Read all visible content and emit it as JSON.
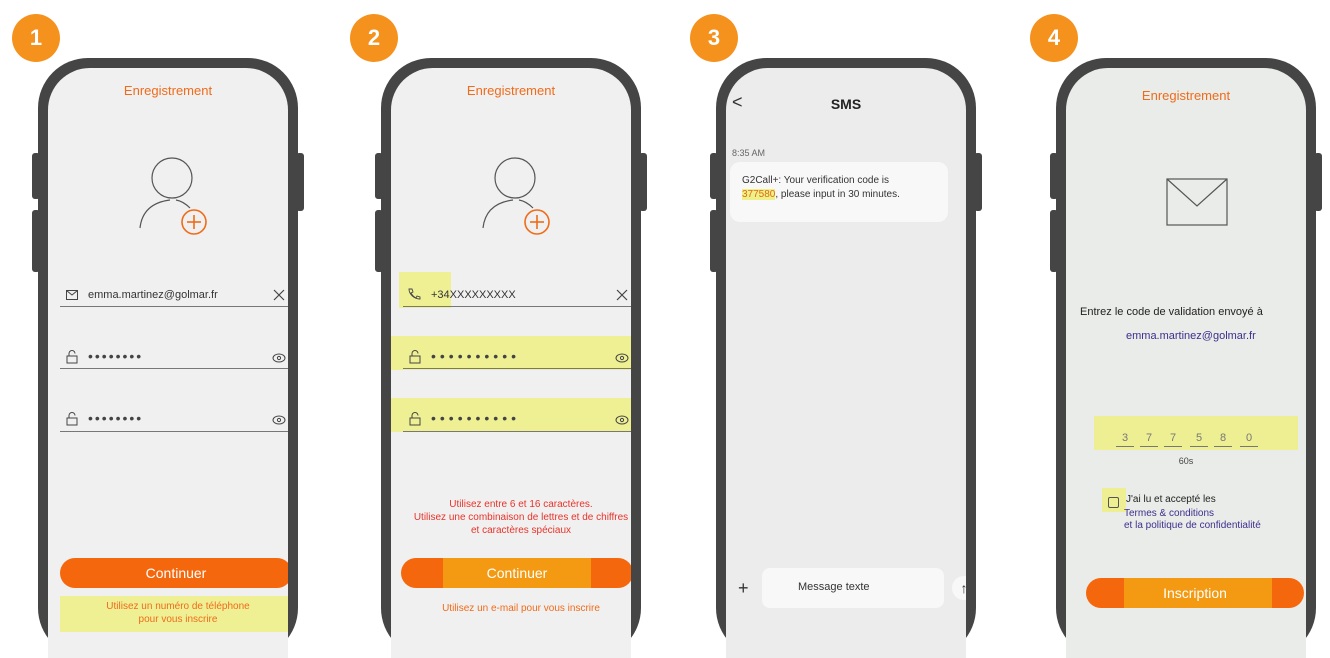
{
  "steps": [
    "1",
    "2",
    "3",
    "4"
  ],
  "screen1": {
    "title": "Enregistrement",
    "email_value": "emma.martinez@golmar.fr",
    "password_mask": "••••••••",
    "confirm_mask": "••••••••",
    "continue_label": "Continuer",
    "phone_link_line1": "Utilisez un numéro de téléphone",
    "phone_link_line2": "pour vous inscrire"
  },
  "screen2": {
    "title": "Enregistrement",
    "phone_value": "+34XXXXXXXXX",
    "password_mask": "••••••••••",
    "confirm_mask": "••••••••••",
    "rules_line1": "Utilisez entre 6 et 16 caractères.",
    "rules_line2": "Utilisez une combinaison de lettres et de chiffres",
    "rules_line3": "et caractères spéciaux",
    "continue_label": "Continuer",
    "email_link": "Utilisez un e-mail pour vous inscrire"
  },
  "screen3": {
    "header": "SMS",
    "back": "<",
    "time": "8:35 AM",
    "message_prefix": "G2Call+: Your verification code is",
    "code": "377580",
    "message_suffix": ", please input in 30 minutes.",
    "input_placeholder": "Message texte",
    "plus": "+",
    "send": "↑"
  },
  "screen4": {
    "title": "Enregistrement",
    "prompt": "Entrez le code de validation envoyé à",
    "email": "emma.martinez@golmar.fr",
    "code_digits": [
      "3",
      "7",
      "7",
      "5",
      "8",
      "0"
    ],
    "timer": "60s",
    "accept_text": "J'ai lu et accepté les",
    "terms_link": "Termes & conditions",
    "privacy_link": "et la politique de confidentialité",
    "submit_label": "Inscription"
  },
  "colors": {
    "accent": "#f5670c",
    "badge": "#f5921e",
    "highlight": "#eef08a",
    "link": "#3d2f8f"
  }
}
